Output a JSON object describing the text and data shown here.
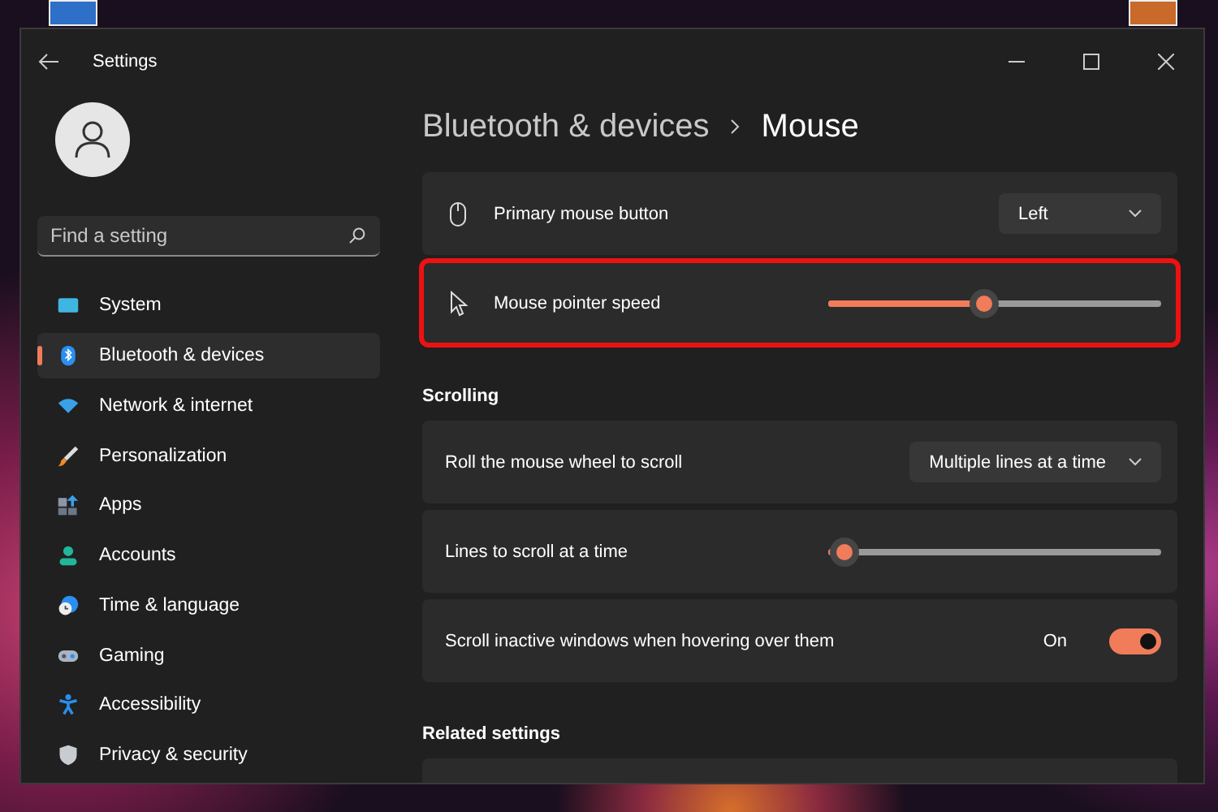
{
  "window": {
    "title": "Settings"
  },
  "sidebar": {
    "search": {
      "placeholder": "Find a setting"
    },
    "items": [
      {
        "label": "System",
        "selected": false
      },
      {
        "label": "Bluetooth & devices",
        "selected": true
      },
      {
        "label": "Network & internet",
        "selected": false
      },
      {
        "label": "Personalization",
        "selected": false
      },
      {
        "label": "Apps",
        "selected": false
      },
      {
        "label": "Accounts",
        "selected": false
      },
      {
        "label": "Time & language",
        "selected": false
      },
      {
        "label": "Gaming",
        "selected": false
      },
      {
        "label": "Accessibility",
        "selected": false
      },
      {
        "label": "Privacy & security",
        "selected": false
      }
    ]
  },
  "breadcrumb": [
    "Bluetooth & devices",
    "Mouse"
  ],
  "sections": [
    {
      "cards": [
        {
          "kind": "dropdown",
          "label": "Primary mouse button",
          "value": "Left",
          "highlighted": false
        },
        {
          "kind": "slider",
          "label": "Mouse pointer speed",
          "level": 0.47,
          "highlighted": true
        }
      ]
    },
    {
      "heading": "Scrolling",
      "cards": [
        {
          "kind": "dropdown",
          "label": "Roll the mouse wheel to scroll",
          "value": "Multiple lines at a time",
          "highlighted": false
        },
        {
          "kind": "slider",
          "label": "Lines to scroll at a time",
          "level": 0.05,
          "highlighted": false
        },
        {
          "kind": "toggle",
          "label": "Scroll inactive windows when hovering over them",
          "on": true,
          "state_label": "On",
          "highlighted": false
        }
      ]
    },
    {
      "heading": "Related settings",
      "cards": [
        {
          "kind": "cut",
          "highlighted": false
        }
      ]
    }
  ]
}
